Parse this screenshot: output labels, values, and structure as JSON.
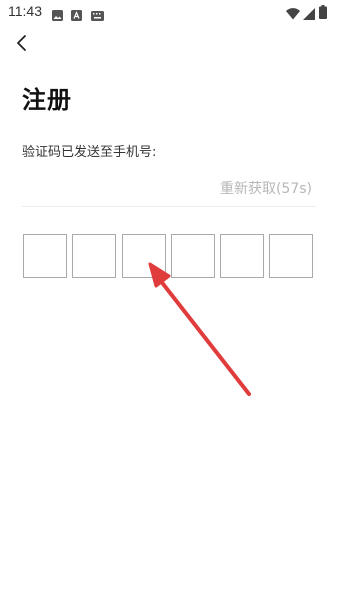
{
  "status_bar": {
    "time": "11:43",
    "left_icons": [
      "image-icon",
      "app-icon",
      "keyboard-icon"
    ],
    "right_icons": [
      "wifi-icon",
      "signal-icon",
      "battery-icon"
    ]
  },
  "nav": {
    "back_icon": "chevron-left-icon"
  },
  "page": {
    "title": "注册",
    "sent_label": "验证码已发送至手机号:",
    "resend_label": "重新获取(57s)",
    "code_length": 6
  },
  "colors": {
    "text_dark": "#111111",
    "muted_text": "#b7b7b7",
    "box_border": "#a9a9a9",
    "annotation_arrow": "#e03c3c"
  }
}
